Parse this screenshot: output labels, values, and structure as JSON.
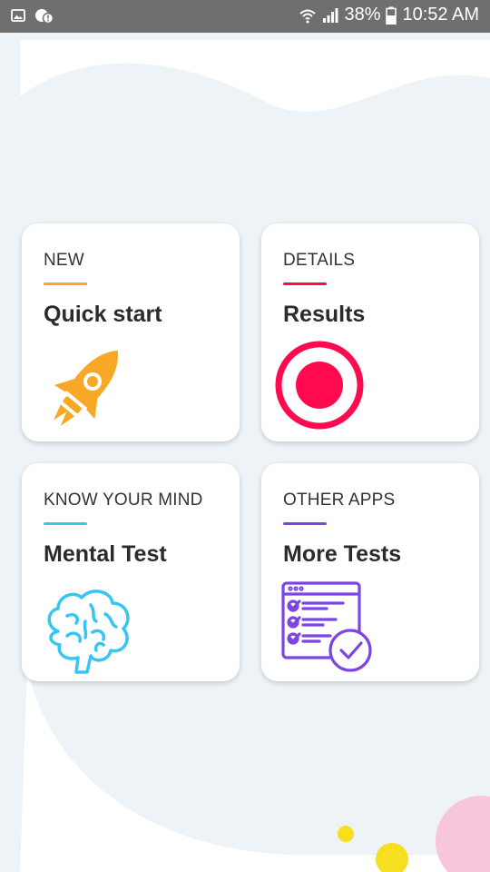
{
  "status_bar": {
    "battery": "38%",
    "time": "10:52 AM",
    "icons": [
      "gallery-icon",
      "alert-badge-icon",
      "wifi-icon",
      "signal-icon",
      "battery-icon"
    ]
  },
  "cards": [
    {
      "eyebrow": "NEW",
      "title": "Quick start",
      "accent": "#f9a825",
      "icon": "rocket-icon"
    },
    {
      "eyebrow": "DETAILS",
      "title": "Results",
      "accent": "#ff0a4f",
      "icon": "record-icon"
    },
    {
      "eyebrow": "KNOW YOUR MIND",
      "title": "Mental Test",
      "accent": "#37c6f4",
      "icon": "brain-icon"
    },
    {
      "eyebrow": "OTHER APPS",
      "title": "More Tests",
      "accent": "#7b45e3",
      "icon": "checklist-icon"
    }
  ]
}
